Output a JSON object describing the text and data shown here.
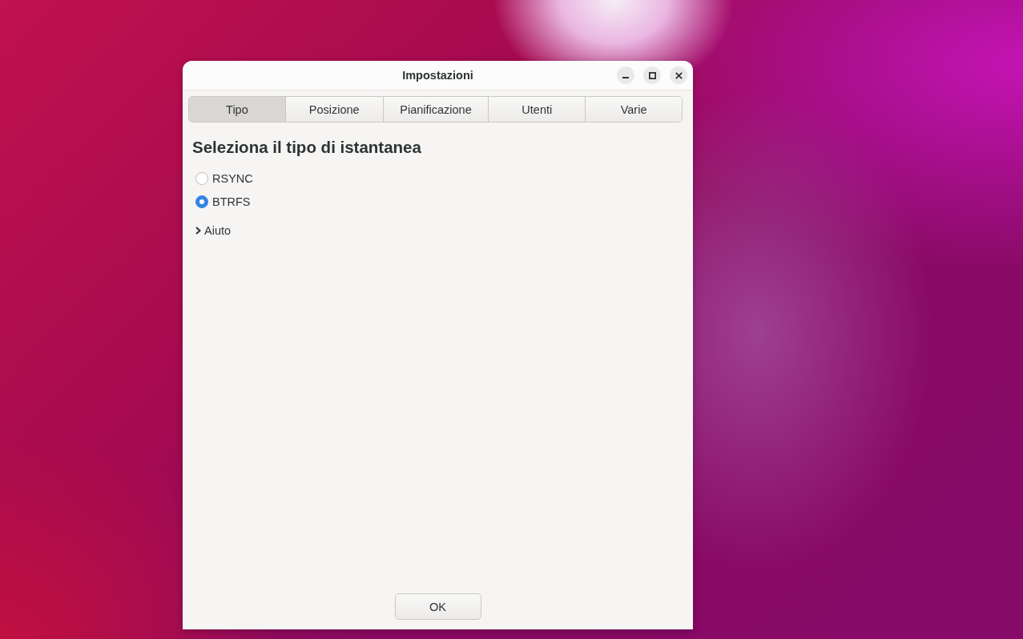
{
  "window": {
    "title": "Impostazioni"
  },
  "tabs": [
    {
      "label": "Tipo",
      "selected": true
    },
    {
      "label": "Posizione",
      "selected": false
    },
    {
      "label": "Pianificazione",
      "selected": false
    },
    {
      "label": "Utenti",
      "selected": false
    },
    {
      "label": "Varie",
      "selected": false
    }
  ],
  "heading": "Seleziona il tipo di istantanea",
  "snapshot_types": [
    {
      "label": "RSYNC",
      "selected": false
    },
    {
      "label": "BTRFS",
      "selected": true
    }
  ],
  "help_expander": {
    "label": "Aiuto",
    "expanded": false
  },
  "buttons": [
    {
      "label": "OK"
    }
  ]
}
